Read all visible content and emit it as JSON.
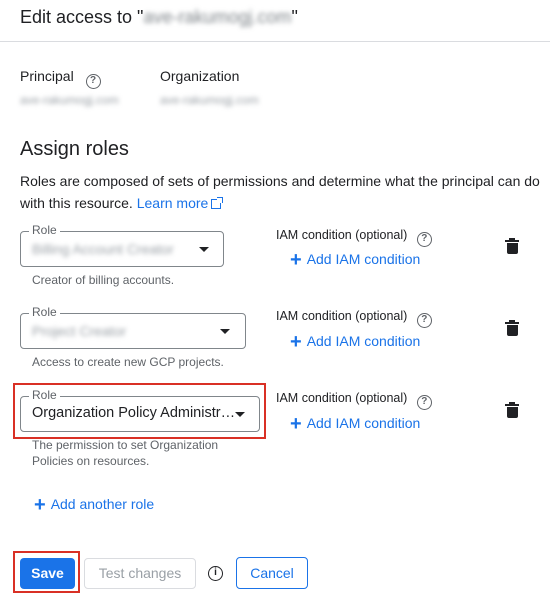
{
  "dialog": {
    "title_prefix": "Edit access to \"",
    "title_resource": "ave-rakumogj.com",
    "title_suffix": "\""
  },
  "principal": {
    "label": "Principal",
    "value": "ave-rakumogj.com"
  },
  "organization": {
    "label": "Organization",
    "value": "ave-rakumogj.com"
  },
  "assign_roles": {
    "title": "Assign roles",
    "description": "Roles are composed of sets of permissions and determine what the principal can do with this resource.",
    "learn_more": "Learn more"
  },
  "roles": [
    {
      "legend": "Role",
      "value": "Billing Account Creator",
      "hint": "Creator of billing accounts.",
      "condition_label": "IAM condition (optional)",
      "add_condition": "Add IAM condition"
    },
    {
      "legend": "Role",
      "value": "Project Creator",
      "hint": "Access to create new GCP projects.",
      "condition_label": "IAM condition (optional)",
      "add_condition": "Add IAM condition"
    },
    {
      "legend": "Role",
      "value": "Organization Policy Administr…",
      "hint": "The permission to set Organization Policies on resources.",
      "condition_label": "IAM condition (optional)",
      "add_condition": "Add IAM condition"
    }
  ],
  "add_another_role": "Add another role",
  "footer": {
    "save": "Save",
    "test_changes": "Test changes",
    "cancel": "Cancel"
  },
  "icons": {
    "help": "help-circle-icon",
    "external": "open-in-new-icon",
    "dropdown": "arrow-drop-down-icon",
    "delete": "trash-icon",
    "add": "plus-icon",
    "info": "info-icon"
  },
  "colors": {
    "primary": "#1a73e8",
    "highlight": "#d93025",
    "text": "#202124",
    "secondary_text": "#5f6368"
  }
}
